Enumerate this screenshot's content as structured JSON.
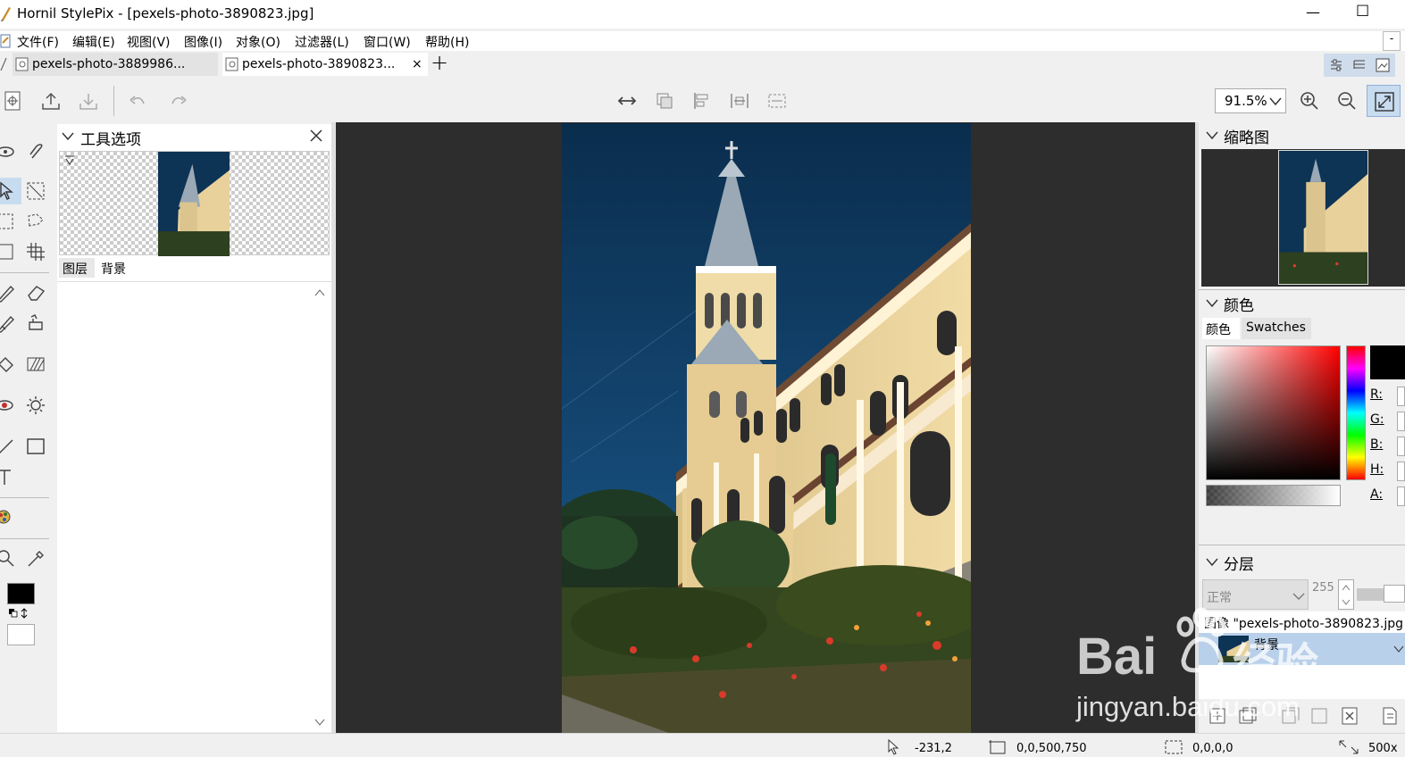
{
  "window": {
    "title": "Hornil StylePix - [pexels-photo-3890823.jpg]",
    "minimize": "—",
    "maximize": "☐"
  },
  "menu": [
    "文件(F)",
    "编辑(E)",
    "视图(V)",
    "图像(I)",
    "对象(O)",
    "过滤器(L)",
    "窗口(W)",
    "帮助(H)"
  ],
  "tabs": [
    {
      "label": "pexels-photo-3889986..."
    },
    {
      "label": "pexels-photo-3890823...",
      "close": "×"
    }
  ],
  "new_tab": "+",
  "toolbar": {
    "zoom_value": "91.5%"
  },
  "tool_options": {
    "title": "工具选项",
    "tab_layers": "图层",
    "tab_background": "背景"
  },
  "thumbnail_panel": {
    "title": "缩略图"
  },
  "color_panel": {
    "title": "颜色",
    "tab_color": "颜色",
    "tab_swatches": "Swatches",
    "labels": [
      "R:",
      "G:",
      "B:",
      "H:",
      "A:"
    ]
  },
  "layers_panel": {
    "title": "分层",
    "blend_mode": "正常",
    "opacity": "255",
    "image_row": "图像 \"pexels-photo-3890823.jpg",
    "layer_name": "背景"
  },
  "status": {
    "cursor": "-231,2",
    "image_rect": "0,0,500,750",
    "selection": "0,0,0,0",
    "size": "500x"
  },
  "watermark": {
    "brand": "Bai",
    "brand_cn": "经验",
    "url": "jingyan.baidu.com"
  },
  "colors": {
    "canvas_bg": "#2d2d2d",
    "selected_layer": "#b9d0ea",
    "active_tool": "#c8dcf0",
    "fg": "#000000",
    "bg": "#ffffff"
  }
}
